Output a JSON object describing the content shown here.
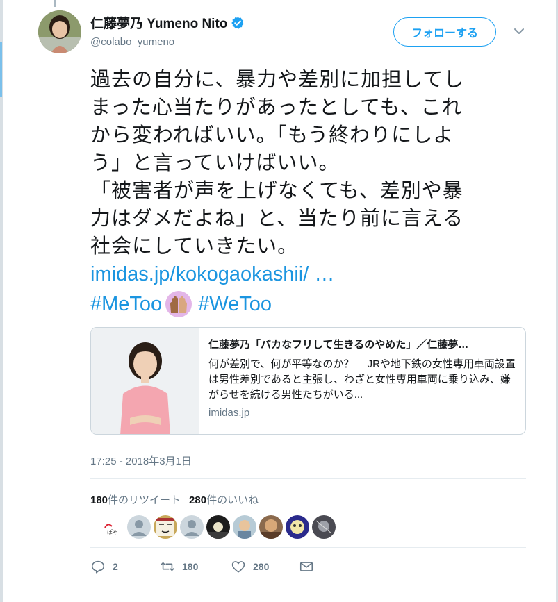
{
  "user": {
    "display_name": "仁藤夢乃 Yumeno Nito",
    "handle": "@colabo_yumeno",
    "verified": true
  },
  "follow_button": {
    "label": "フォローする"
  },
  "tweet": {
    "lines": [
      "過去の自分に、暴力や差別に加担してし",
      "まった心当たりがあったとしても、これ",
      "から変わればいい。「もう終わりにしよ",
      "う」と言っていけばいい。",
      "「被害者が声を上げなくても、差別や暴",
      "力はダメだよね」と、当たり前に言える",
      "社会にしていきたい。"
    ],
    "link": "imidas.jp/kokogaokashii/ …",
    "hashtag_1": "#MeToo",
    "hashtag_2": "#WeToo"
  },
  "link_card": {
    "title": "仁藤夢乃「バカなフリして生きるのやめた」／仁藤夢…",
    "description": "何が差別で、何が平等なのか？　 JRや地下鉄の女性専用車両設置は男性差別であると主張し、わざと女性専用車両に乗り込み、嫌がらせを続ける男性たちがいる...",
    "domain": "imidas.jp"
  },
  "timestamp": "17:25 - 2018年3月1日",
  "stats": {
    "retweet_count": "180",
    "retweet_label": "件のリツイート",
    "like_count": "280",
    "like_label": "件のいいね"
  },
  "actions": {
    "reply_count": "2",
    "retweet_count": "180",
    "like_count": "280"
  },
  "colors": {
    "accent": "#1da1f2",
    "link": "#1b95e0",
    "secondary_text": "#657786",
    "border": "#e6ecf0"
  }
}
